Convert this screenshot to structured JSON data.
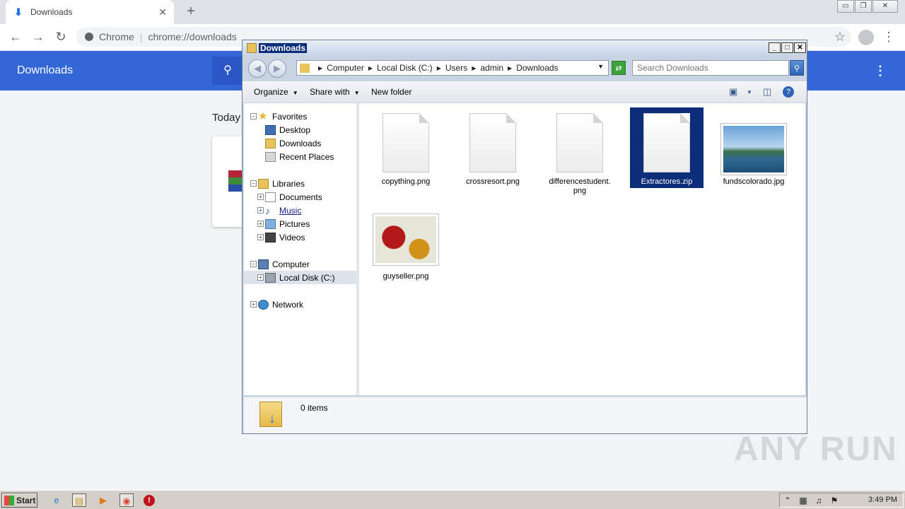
{
  "browser": {
    "tab_title": "Downloads",
    "scheme_label": "Chrome",
    "url": "chrome://downloads"
  },
  "downloads_page": {
    "header_title": "Downloads",
    "section_label": "Today"
  },
  "explorer": {
    "title": "Downloads",
    "breadcrumb": [
      "Computer",
      "Local Disk (C:)",
      "Users",
      "admin",
      "Downloads"
    ],
    "search_placeholder": "Search Downloads",
    "commands": {
      "organize": "Organize",
      "share_with": "Share with",
      "new_folder": "New folder"
    },
    "nav": {
      "favorites": "Favorites",
      "desktop": "Desktop",
      "downloads": "Downloads",
      "recent_places": "Recent Places",
      "libraries": "Libraries",
      "documents": "Documents",
      "music": "Music",
      "pictures": "Pictures",
      "videos": "Videos",
      "computer": "Computer",
      "local_disk": "Local Disk (C:)",
      "network": "Network"
    },
    "files": [
      {
        "name": "copything.png"
      },
      {
        "name": "crossresort.png"
      },
      {
        "name": "differencestudent.\npng"
      },
      {
        "name": "Extractores.zip",
        "selected": true
      },
      {
        "name": "fundscolorado.jpg"
      },
      {
        "name": "guyseller.png"
      }
    ],
    "status": "0 items"
  },
  "taskbar": {
    "start_label": "Start",
    "clock": "3:49 PM"
  },
  "watermark": "ANY RUN"
}
